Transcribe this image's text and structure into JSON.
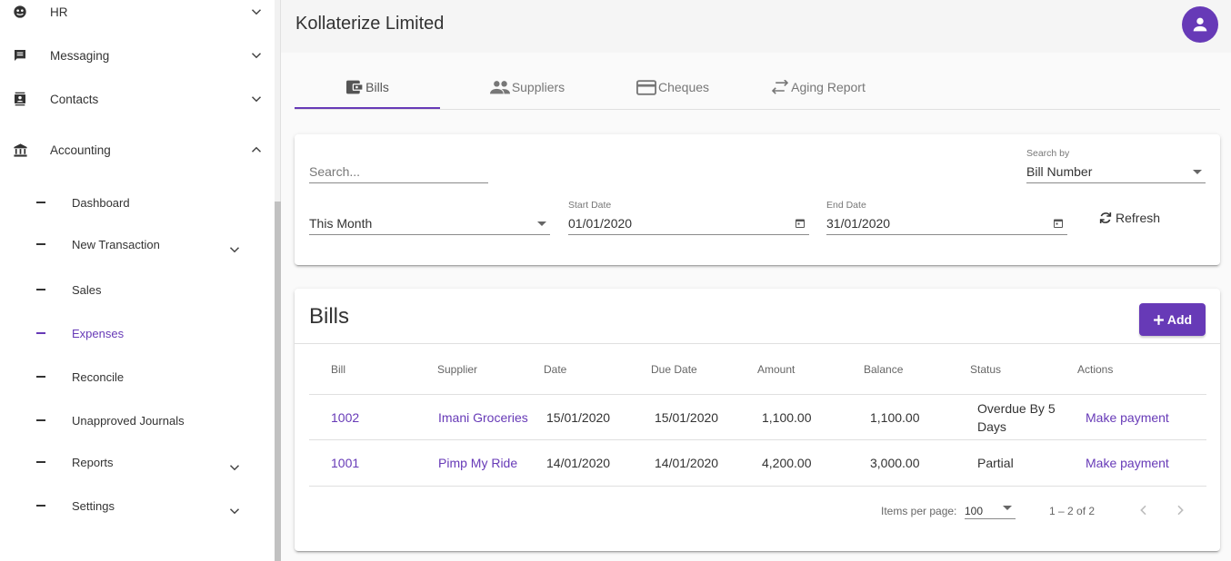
{
  "sidebar": {
    "items": [
      {
        "label": "HR",
        "icon": "hr-icon"
      },
      {
        "label": "Messaging",
        "icon": "message-icon"
      },
      {
        "label": "Contacts",
        "icon": "contacts-icon"
      },
      {
        "label": "Accounting",
        "icon": "bank-icon"
      }
    ],
    "subitems": [
      {
        "label": "Dashboard"
      },
      {
        "label": "New Transaction"
      },
      {
        "label": "Sales"
      },
      {
        "label": "Expenses"
      },
      {
        "label": "Reconcile"
      },
      {
        "label": "Unapproved Journals"
      },
      {
        "label": "Reports"
      },
      {
        "label": "Settings"
      }
    ]
  },
  "header": {
    "org_name": "Kollaterize Limited"
  },
  "tabs": [
    {
      "label": "Bills"
    },
    {
      "label": "Suppliers"
    },
    {
      "label": "Cheques"
    },
    {
      "label": "Aging Report"
    }
  ],
  "filters": {
    "search_placeholder": "Search...",
    "search_by_label": "Search by",
    "search_by_value": "Bill Number",
    "period_value": "This Month",
    "start_date_label": "Start Date",
    "start_date_value": "01/01/2020",
    "end_date_label": "End Date",
    "end_date_value": "31/01/2020",
    "refresh_label": "Refresh"
  },
  "bills": {
    "title": "Bills",
    "add_label": "Add",
    "columns": [
      "Bill",
      "Supplier",
      "Date",
      "Due Date",
      "Amount",
      "Balance",
      "Status",
      "Actions"
    ],
    "rows": [
      {
        "bill": "1002",
        "supplier": "Imani Groceries",
        "date": "15/01/2020",
        "due_date": "15/01/2020",
        "amount": "1,100.00",
        "balance": "1,100.00",
        "status_line1": "Overdue By 5",
        "status_line2": "Days",
        "action": "Make payment"
      },
      {
        "bill": "1001",
        "supplier": "Pimp My Ride",
        "date": "14/01/2020",
        "due_date": "14/01/2020",
        "amount": "4,200.00",
        "balance": "3,000.00",
        "status_line1": "Partial",
        "status_line2": "",
        "action": "Make payment"
      }
    ],
    "paginator": {
      "items_per_page_label": "Items per page:",
      "items_per_page_value": "100",
      "range_label": "1 – 2 of 2"
    }
  },
  "colors": {
    "accent": "#673ab7"
  }
}
